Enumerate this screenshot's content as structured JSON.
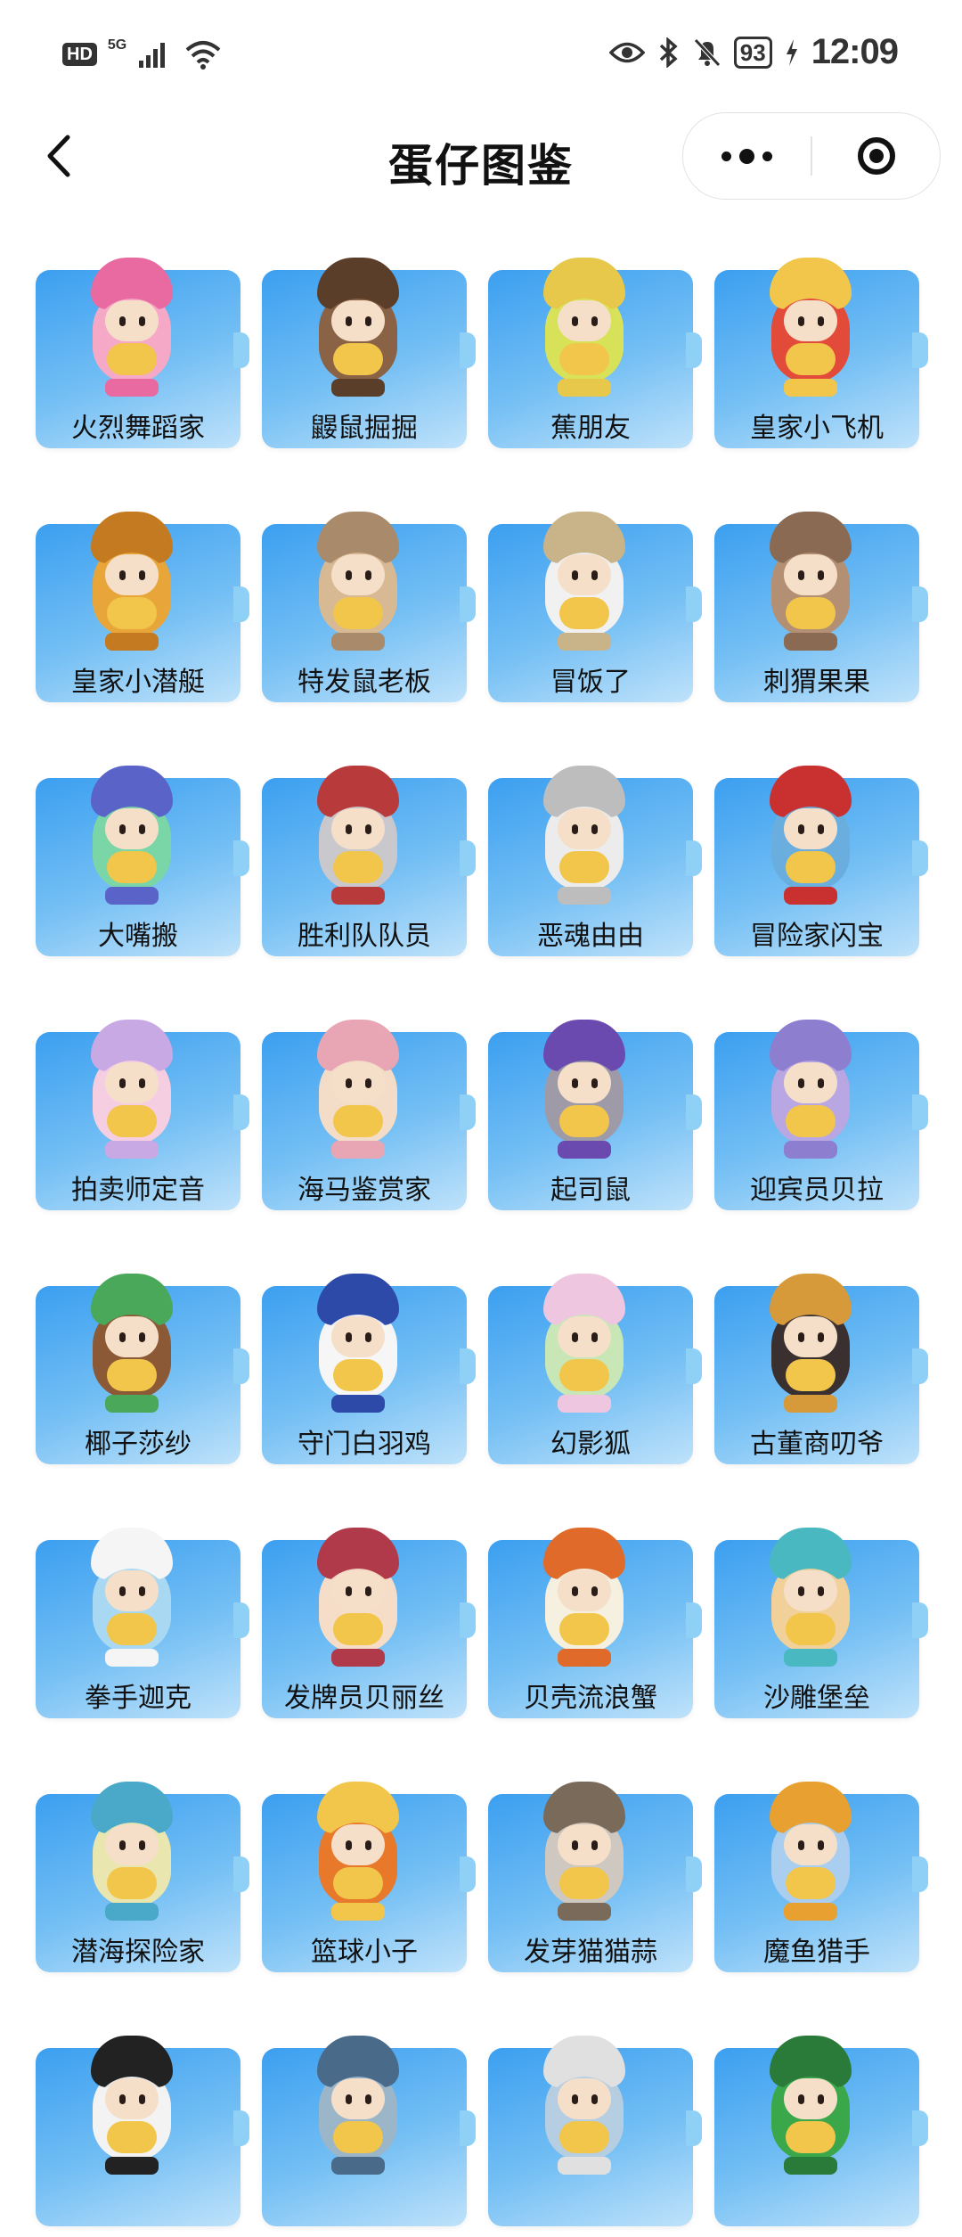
{
  "status_bar": {
    "hd_label": "HD",
    "network_label": "5G",
    "battery": "93",
    "time": "12:09"
  },
  "nav": {
    "title": "蛋仔图鉴"
  },
  "items": [
    {
      "name": "火烈舞蹈家",
      "color": "#f4a9c6",
      "accent": "#e86aa0"
    },
    {
      "name": "鼹鼠掘掘",
      "color": "#8a6246",
      "accent": "#5b3e2a"
    },
    {
      "name": "蕉朋友",
      "color": "#d8e25a",
      "accent": "#e7c84a"
    },
    {
      "name": "皇家小飞机",
      "color": "#e24a3a",
      "accent": "#f2c64a"
    },
    {
      "name": "皇家小潜艇",
      "color": "#e8a53a",
      "accent": "#c47a20"
    },
    {
      "name": "特发鼠老板",
      "color": "#d7b894",
      "accent": "#a98a6a"
    },
    {
      "name": "冒饭了",
      "color": "#f0f0f0",
      "accent": "#c9b48a"
    },
    {
      "name": "刺猬果果",
      "color": "#b39074",
      "accent": "#8a6a52"
    },
    {
      "name": "大嘴搬",
      "color": "#7bd6a7",
      "accent": "#5a63c8"
    },
    {
      "name": "胜利队队员",
      "color": "#c8c8cc",
      "accent": "#b83a3a"
    },
    {
      "name": "恶魂由由",
      "color": "#ececec",
      "accent": "#bdbdbd"
    },
    {
      "name": "冒险家闪宝",
      "color": "#6aaede",
      "accent": "#c93030"
    },
    {
      "name": "拍卖师定音",
      "color": "#f6cde0",
      "accent": "#c9a9e4"
    },
    {
      "name": "海马鉴赏家",
      "color": "#f2dcc8",
      "accent": "#e8a6b4"
    },
    {
      "name": "起司鼠",
      "color": "#9e9aa8",
      "accent": "#6b4ab0"
    },
    {
      "name": "迎宾员贝拉",
      "color": "#b7a6e2",
      "accent": "#8d7ed0"
    },
    {
      "name": "椰子莎纱",
      "color": "#8b5a36",
      "accent": "#4aa85a"
    },
    {
      "name": "守门白羽鸡",
      "color": "#f5f5f5",
      "accent": "#2e4aa8"
    },
    {
      "name": "幻影狐",
      "color": "#c9e6b6",
      "accent": "#eec6e0"
    },
    {
      "name": "古董商叨爷",
      "color": "#3a3030",
      "accent": "#d69a3a"
    },
    {
      "name": "拳手迦克",
      "color": "#a9d8f2",
      "accent": "#f5f5f5"
    },
    {
      "name": "发牌员贝丽丝",
      "color": "#f4dcc8",
      "accent": "#b03a4a"
    },
    {
      "name": "贝壳流浪蟹",
      "color": "#f5efe0",
      "accent": "#e06a2a"
    },
    {
      "name": "沙雕堡垒",
      "color": "#f0d09a",
      "accent": "#4ab8c0"
    },
    {
      "name": "潜海探险家",
      "color": "#e9e6b0",
      "accent": "#4aa8c8"
    },
    {
      "name": "篮球小子",
      "color": "#e8782a",
      "accent": "#f2c64a"
    },
    {
      "name": "发芽猫猫蒜",
      "color": "#cfc8c0",
      "accent": "#7a6a5a"
    },
    {
      "name": "魔鱼猎手",
      "color": "#a9cdee",
      "accent": "#e8a030"
    },
    {
      "name": "",
      "color": "#f2f2f2",
      "accent": "#222222"
    },
    {
      "name": "",
      "color": "#9bb6c8",
      "accent": "#4a6a8a"
    },
    {
      "name": "",
      "color": "#b6cde0",
      "accent": "#e0e0e0"
    },
    {
      "name": "",
      "color": "#3aa84a",
      "accent": "#2a7a3a"
    }
  ]
}
